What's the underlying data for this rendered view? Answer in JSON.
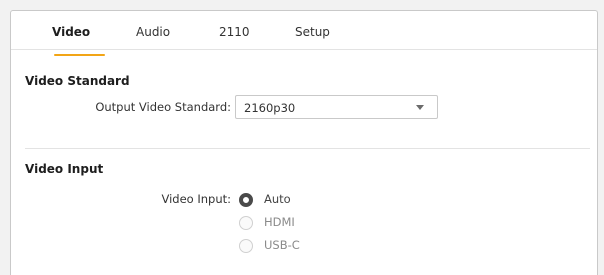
{
  "tabs": [
    {
      "label": "Video",
      "active": true
    },
    {
      "label": "Audio",
      "active": false
    },
    {
      "label": "2110",
      "active": false
    },
    {
      "label": "Setup",
      "active": false
    }
  ],
  "accent_color": "#f2a516",
  "video_standard": {
    "title": "Video Standard",
    "output_label": "Output Video Standard:",
    "output_value": "2160p30"
  },
  "video_input": {
    "title": "Video Input",
    "label": "Video Input:",
    "options": [
      {
        "label": "Auto",
        "selected": true
      },
      {
        "label": "HDMI",
        "selected": false
      },
      {
        "label": "USB-C",
        "selected": false
      }
    ]
  }
}
